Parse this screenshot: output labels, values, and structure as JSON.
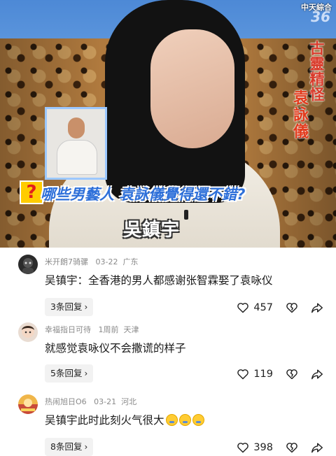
{
  "video": {
    "studio_logo": "中天綜合",
    "studio_number": "36",
    "side_title": "古靈精怪",
    "side_name": "袁詠儀",
    "question_mark": "?",
    "question_text": "哪些男藝人 袁詠儀覺得還不錯?",
    "name_caption": "吳鎮宇"
  },
  "comments": [
    {
      "user": "米开朗7骑骡",
      "date": "03-22",
      "location": "广东",
      "text": "吴镇宇：全香港的男人都感谢张智霖娶了袁咏仪",
      "replies": "3条回复",
      "likes": "457",
      "avatar": "dark-cartoon-avatar"
    },
    {
      "user": "幸福指日可待",
      "date": "1周前",
      "location": "天津",
      "text": "就感觉袁咏仪不会撒谎的样子",
      "replies": "5条回复",
      "likes": "119",
      "avatar": "child-photo-avatar"
    },
    {
      "user": "热闹旭日O6",
      "date": "03-21",
      "location": "河北",
      "text": "吴镇宇此时此刻火气很大",
      "emojis": [
        "crying-laughing-emoji",
        "crying-laughing-emoji",
        "crying-laughing-emoji"
      ],
      "replies": "8条回复",
      "likes": "398",
      "avatar": "colorful-avatar"
    }
  ],
  "icons": {
    "like": "heart-outline-icon",
    "dislike": "broken-heart-icon",
    "share": "share-arrow-icon",
    "reply_chevron": "chevron-right-icon"
  },
  "reply_chevron": "›"
}
